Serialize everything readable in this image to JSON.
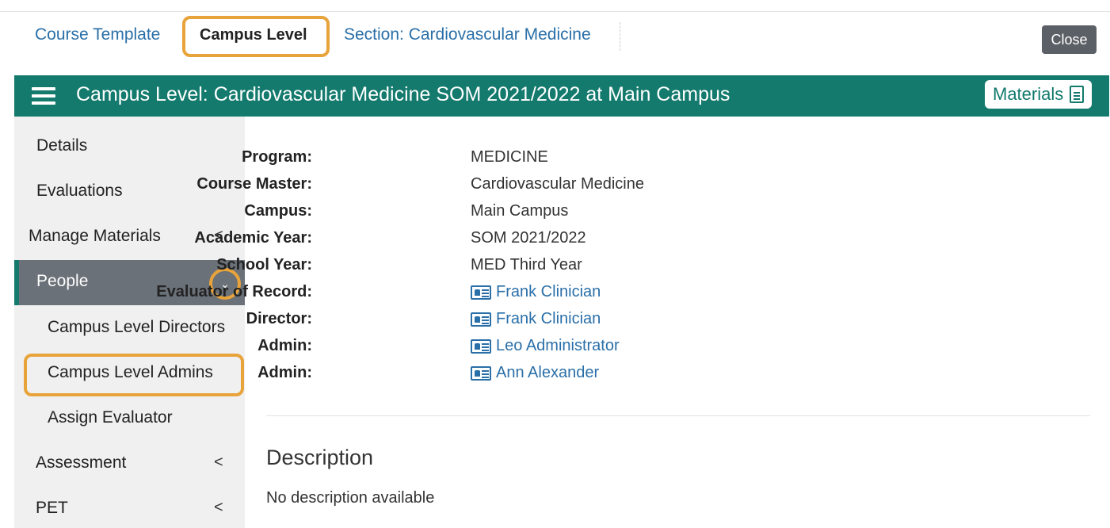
{
  "breadcrumbs": [
    {
      "label": "Course Template"
    },
    {
      "label": "Campus Level"
    },
    {
      "label": "Section: Cardiovascular Medicine"
    }
  ],
  "close_label": "Close",
  "header": {
    "title": "Campus Level: Cardiovascular Medicine SOM 2021/2022 at Main Campus",
    "materials_label": "Materials",
    "accent_color": "#137a6d"
  },
  "sidebar": {
    "items": [
      {
        "label": "Details"
      },
      {
        "label": "Evaluations"
      },
      {
        "label": "Manage Materials",
        "chevron": "<"
      },
      {
        "label": "People"
      },
      {
        "label": "Campus Level Directors"
      },
      {
        "label": "Campus Level Admins"
      },
      {
        "label": "Assign Evaluator"
      },
      {
        "label": "Assessment",
        "chevron": "<"
      },
      {
        "label": "PET",
        "chevron": "<"
      }
    ]
  },
  "details": [
    {
      "key": "Program:",
      "value": "MEDICINE"
    },
    {
      "key": "Course Master:",
      "value": "Cardiovascular Medicine"
    },
    {
      "key": "Campus:",
      "value": "Main Campus"
    },
    {
      "key": "Academic Year:",
      "value": "SOM 2021/2022"
    },
    {
      "key": "School Year:",
      "value": "MED Third Year"
    },
    {
      "key": "Evaluator of Record:",
      "value": "Frank Clinician"
    },
    {
      "key": "Director:",
      "value": "Frank Clinician"
    },
    {
      "key": "Admin:",
      "value": "Leo Administrator"
    },
    {
      "key": "Admin:",
      "value": "Ann Alexander"
    }
  ],
  "description": {
    "title": "Description",
    "text": "No description available"
  },
  "highlight_color": "#e8a33a"
}
